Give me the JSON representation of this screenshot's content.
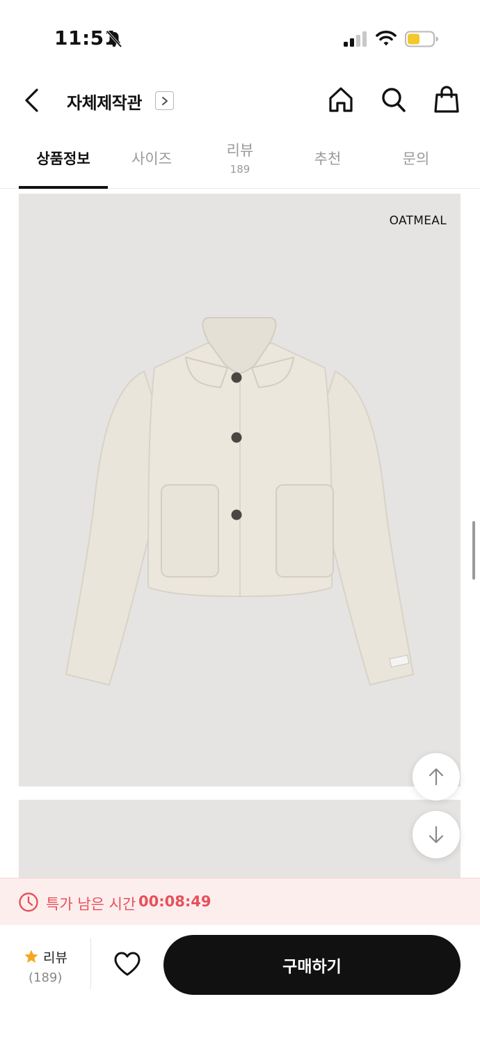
{
  "status_bar": {
    "time": "11:51",
    "icons": [
      "bell-slash-icon",
      "signal-icon",
      "wifi-icon",
      "battery-icon"
    ]
  },
  "header": {
    "title": "자체제작관",
    "icons": [
      "back-icon",
      "chevron-right-icon",
      "home-icon",
      "search-icon",
      "shopping-bag-icon"
    ]
  },
  "tabs": [
    {
      "label": "상품정보",
      "active": true
    },
    {
      "label": "사이즈"
    },
    {
      "label": "리뷰",
      "count": "189"
    },
    {
      "label": "추천"
    },
    {
      "label": "문의"
    }
  ],
  "product": {
    "color_label": "OATMEAL",
    "image_background": "#e6e4e2",
    "jacket_color": "#ebe7dd"
  },
  "timer": {
    "text": "특가 남은 시간",
    "value": "00:08:49",
    "color": "#e8505b",
    "background": "#fdeeee"
  },
  "bottom_bar": {
    "review_label": "리뷰",
    "review_count": "(189)",
    "buy_label": "구매하기",
    "star_color": "#f5a623"
  }
}
